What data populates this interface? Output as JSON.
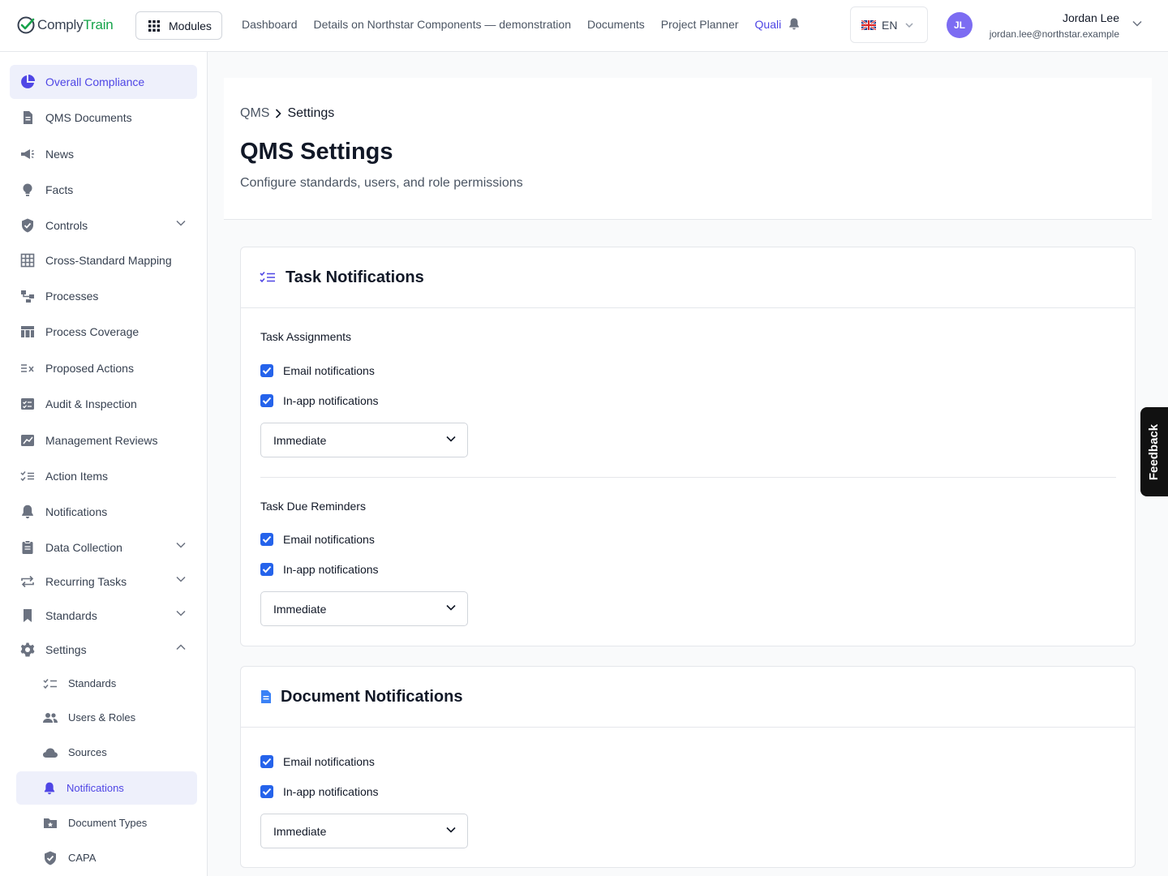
{
  "app": {
    "logo_part1": "Comply",
    "logo_part2": "Train",
    "brand_color": "#16a34a",
    "accent_color": "#4f46e5"
  },
  "topbar": {
    "modules_label": "Modules",
    "nav": [
      {
        "label": "Dashboard"
      },
      {
        "label": "Details on Northstar Components — demonstration"
      },
      {
        "label": "Documents"
      },
      {
        "label": "Project Planner"
      },
      {
        "label": "Quali",
        "active": true
      }
    ],
    "language": "EN",
    "user": {
      "initials": "JL",
      "name": "Jordan Lee",
      "email": "jordan.lee@northstar.example"
    }
  },
  "sidebar": {
    "items": [
      {
        "label": "Overall Compliance",
        "icon": "pie-chart-icon",
        "active": true
      },
      {
        "label": "QMS Documents",
        "icon": "document-icon"
      },
      {
        "label": "News",
        "icon": "megaphone-icon"
      },
      {
        "label": "Facts",
        "icon": "lightbulb-icon"
      },
      {
        "label": "Controls",
        "icon": "shield-check-icon",
        "expandable": true
      },
      {
        "label": "Cross-Standard Mapping",
        "icon": "grid-icon"
      },
      {
        "label": "Processes",
        "icon": "flow-icon"
      },
      {
        "label": "Process Coverage",
        "icon": "table-icon"
      },
      {
        "label": "Proposed Actions",
        "icon": "list-x-icon"
      },
      {
        "label": "Audit & Inspection",
        "icon": "checklist-icon"
      },
      {
        "label": "Management Reviews",
        "icon": "chart-edit-icon"
      },
      {
        "label": "Action Items",
        "icon": "list-check-icon"
      },
      {
        "label": "Notifications",
        "icon": "bell-icon"
      },
      {
        "label": "Data Collection",
        "icon": "clipboard-icon",
        "expandable": true
      },
      {
        "label": "Recurring Tasks",
        "icon": "repeat-icon",
        "expandable": true
      },
      {
        "label": "Standards",
        "icon": "bookmark-icon",
        "expandable": true
      },
      {
        "label": "Settings",
        "icon": "gear-icon",
        "expanded": true
      }
    ],
    "settings_sub": [
      {
        "label": "Standards",
        "icon": "list-check-icon"
      },
      {
        "label": "Users & Roles",
        "icon": "users-icon"
      },
      {
        "label": "Sources",
        "icon": "cloud-icon"
      },
      {
        "label": "Notifications",
        "icon": "bell-icon",
        "active": true
      },
      {
        "label": "Document Types",
        "icon": "folder-star-icon"
      },
      {
        "label": "CAPA",
        "icon": "shield-check-icon"
      }
    ]
  },
  "header": {
    "breadcrumb": [
      "QMS",
      "Settings"
    ],
    "title": "QMS Settings",
    "subtitle": "Configure standards, users, and role permissions"
  },
  "task_card": {
    "title": "Task Notifications",
    "sections": [
      {
        "title": "Task Assignments",
        "email_label": "Email notifications",
        "email_checked": true,
        "inapp_label": "In-app notifications",
        "inapp_checked": true,
        "frequency": "Immediate"
      },
      {
        "title": "Task Due Reminders",
        "email_label": "Email notifications",
        "email_checked": true,
        "inapp_label": "In-app notifications",
        "inapp_checked": true,
        "frequency": "Immediate"
      }
    ]
  },
  "doc_card": {
    "title": "Document Notifications",
    "email_label": "Email notifications",
    "email_checked": true,
    "inapp_label": "In-app notifications",
    "inapp_checked": true,
    "frequency": "Immediate"
  },
  "feedback_label": "Feedback"
}
